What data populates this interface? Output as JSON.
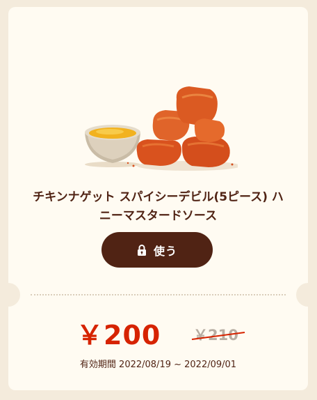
{
  "coupon": {
    "title_line1": "チキンナゲット スパイシーデビル(5ピース) ハ",
    "title_line2": "ニーマスタードソース",
    "use_button_label": "使う",
    "price": "￥200",
    "original_price": "￥210",
    "validity": "有効期間 2022/08/19 ~ 2022/09/01"
  },
  "colors": {
    "background": "#f4ebdc",
    "card": "#fffbf2",
    "brown": "#502314",
    "price_red": "#d62300",
    "muted": "#b7ada2"
  },
  "icons": {
    "use_button": "lock-icon"
  }
}
